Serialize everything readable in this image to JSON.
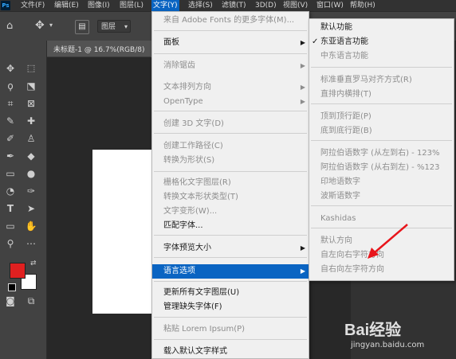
{
  "menubar": {
    "logo": "Ps",
    "items": [
      "文件(F)",
      "编辑(E)",
      "图像(I)",
      "图层(L)",
      "文字(Y)",
      "选择(S)",
      "滤镜(T)",
      "3D(D)",
      "视图(V)",
      "窗口(W)",
      "帮助(H)"
    ],
    "active_index": 4
  },
  "optionsbar": {
    "layer_select": "图层"
  },
  "document": {
    "tab_title": "未标题-1 @ 16.7%(RGB/8)"
  },
  "type_menu": {
    "items": [
      {
        "label": "来自 Adobe Fonts 的更多字体(M)...",
        "disabled": true
      },
      {
        "label": "面板",
        "submenu": true
      },
      {
        "label": "消除锯齿",
        "disabled": true,
        "submenu": true
      },
      {
        "label": "文本排列方向",
        "disabled": true,
        "submenu": true
      },
      {
        "label": "OpenType",
        "disabled": true,
        "submenu": true
      },
      {
        "label": "创建 3D 文字(D)",
        "disabled": true
      },
      {
        "label": "创建工作路径(C)",
        "disabled": true
      },
      {
        "label": "转换为形状(S)",
        "disabled": true
      },
      {
        "label": "栅格化文字图层(R)",
        "disabled": true
      },
      {
        "label": "转换文本形状类型(T)",
        "disabled": true
      },
      {
        "label": "文字变形(W)...",
        "disabled": true
      },
      {
        "label": "匹配字体...",
        "disabled": false
      },
      {
        "label": "字体预览大小",
        "submenu": true
      },
      {
        "label": "语言选项",
        "submenu": true,
        "highlighted": true
      },
      {
        "label": "更新所有文字图层(U)"
      },
      {
        "label": "管理缺失字体(F)"
      },
      {
        "label": "粘贴 Lorem Ipsum(P)",
        "disabled": true
      },
      {
        "label": "载入默认文字样式"
      }
    ]
  },
  "language_submenu": {
    "items": [
      {
        "label": "默认功能"
      },
      {
        "label": "东亚语言功能",
        "checked": true
      },
      {
        "label": "中东语言功能",
        "disabled": true
      },
      {
        "label": "标准垂直罗马对齐方式(R)",
        "disabled": true
      },
      {
        "label": "直排内横排(T)",
        "disabled": true
      },
      {
        "label": "顶到顶行距(P)",
        "disabled": true
      },
      {
        "label": "底到底行距(B)",
        "disabled": true
      },
      {
        "label": "阿拉伯语数字 (从左到右) - 123%",
        "disabled": true
      },
      {
        "label": "阿拉伯语数字 (从右到左) - %123",
        "disabled": true
      },
      {
        "label": "印地语数字",
        "disabled": true
      },
      {
        "label": "波斯语数字",
        "disabled": true
      },
      {
        "label": "Kashidas",
        "disabled": true
      },
      {
        "label": "默认方向",
        "disabled": true
      },
      {
        "label": "自左向右字符方向",
        "disabled": true
      },
      {
        "label": "自右向左字符方向",
        "disabled": true
      }
    ],
    "check_mark": "✓"
  },
  "colors": {
    "foreground": "#e02020",
    "background": "#ffffff",
    "highlight": "#0a64c2",
    "annotation_arrow": "#e8151b"
  },
  "watermark": {
    "brand": "Bai经验",
    "url": "jingyan.baidu.com"
  }
}
